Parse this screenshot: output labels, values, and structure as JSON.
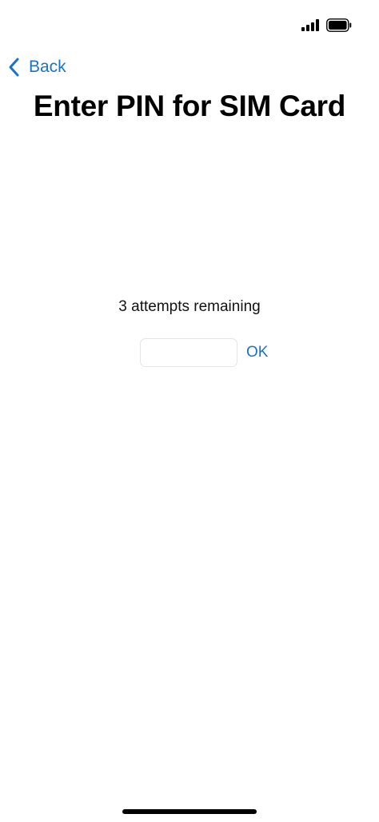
{
  "status_bar": {
    "signal_icon": "cellular-signal-icon",
    "battery_icon": "battery-full-icon"
  },
  "nav": {
    "back_label": "Back",
    "back_icon": "chevron-left-icon"
  },
  "title": "Enter PIN for SIM Card",
  "pin_entry": {
    "attempts_text": "3 attempts remaining",
    "input_value": "",
    "ok_label": "OK"
  },
  "colors": {
    "accent": "#1a73c8",
    "text": "#000000",
    "background": "#ffffff"
  }
}
